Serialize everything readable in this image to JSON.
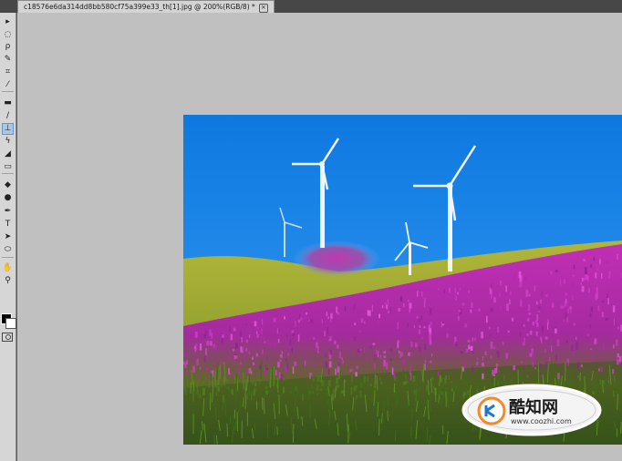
{
  "document": {
    "tab_title": "c18576e6da314dd8bb580cf75a399e33_th[1].jpg @ 200%(RGB/8) *",
    "close_glyph": "×"
  },
  "toolbar": {
    "tools": [
      {
        "name": "move-tool-icon",
        "glyph": "▸"
      },
      {
        "name": "marquee-tool-icon",
        "glyph": "◌"
      },
      {
        "name": "lasso-tool-icon",
        "glyph": "ρ"
      },
      {
        "name": "quick-selection-tool-icon",
        "glyph": "✎"
      },
      {
        "name": "crop-tool-icon",
        "glyph": "⌗"
      },
      {
        "name": "eyedropper-tool-icon",
        "glyph": "⁄"
      },
      {
        "name": "healing-brush-tool-icon",
        "glyph": "▬"
      },
      {
        "name": "brush-tool-icon",
        "glyph": "∕"
      },
      {
        "name": "clone-stamp-tool-icon",
        "glyph": "⊥",
        "active": true
      },
      {
        "name": "history-brush-tool-icon",
        "glyph": "ϟ"
      },
      {
        "name": "eraser-tool-icon",
        "glyph": "◢"
      },
      {
        "name": "gradient-tool-icon",
        "glyph": "▭"
      },
      {
        "name": "blur-tool-icon",
        "glyph": "◆"
      },
      {
        "name": "dodge-tool-icon",
        "glyph": "●"
      },
      {
        "name": "pen-tool-icon",
        "glyph": "✒"
      },
      {
        "name": "type-tool-icon",
        "glyph": "T"
      },
      {
        "name": "path-selection-tool-icon",
        "glyph": "➤"
      },
      {
        "name": "shape-tool-icon",
        "glyph": "⬭"
      },
      {
        "name": "hand-tool-icon",
        "glyph": "✋"
      },
      {
        "name": "zoom-tool-icon",
        "glyph": "⚲"
      }
    ]
  },
  "watermark": {
    "brand": "酷知网",
    "url": "www.coozhi.com"
  },
  "colors": {
    "sky": "#1e88e5",
    "flowers": "#b02aa6",
    "grass": "#8a9a2a",
    "canvas_bg": "#c0c0c0",
    "accent": "#1e78c8"
  }
}
